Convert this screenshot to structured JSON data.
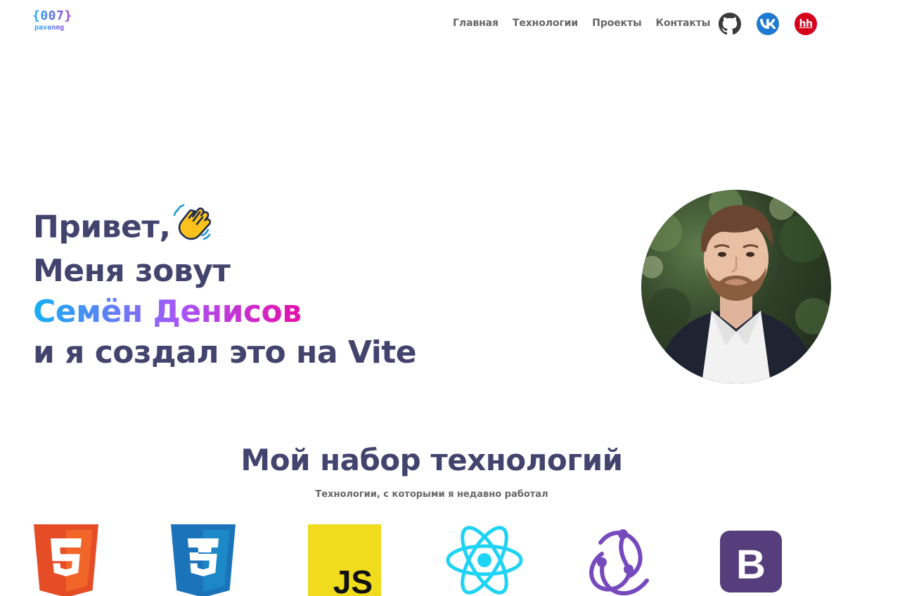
{
  "header": {
    "logo_code": "{007}",
    "logo_name": "pavanmg",
    "nav": [
      {
        "label": "Главная"
      },
      {
        "label": "Технологии"
      },
      {
        "label": "Проекты"
      },
      {
        "label": "Контакты"
      }
    ],
    "socials": [
      {
        "name": "github-icon"
      },
      {
        "name": "vk-icon"
      },
      {
        "name": "hh-icon",
        "text": "hh"
      }
    ]
  },
  "hero": {
    "line1": "Привет,",
    "line2": "Меня зовут",
    "name": "Семён Денисов",
    "line4": "и я создал это на Vite"
  },
  "tech": {
    "title": "Мой набор технологий",
    "subtitle": "Технологии, с которыми я недавно работал",
    "icons": [
      "html5-icon",
      "css3-icon",
      "javascript-icon",
      "react-icon",
      "redux-icon",
      "bootstrap-icon"
    ],
    "js_text": "JS",
    "bootstrap_text": "B"
  },
  "colors": {
    "text": "#42446e",
    "muted": "#666666",
    "gradient_start": "#13b0f5",
    "gradient_end": "#e70faa"
  }
}
